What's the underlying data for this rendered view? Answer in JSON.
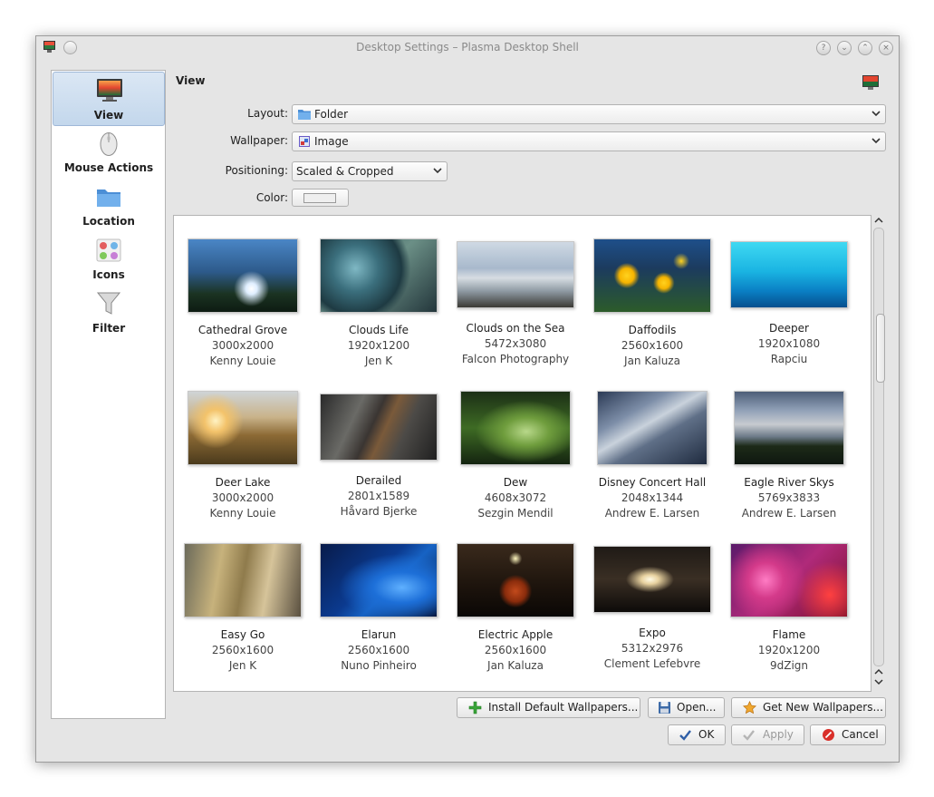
{
  "window": {
    "title": "Desktop Settings – Plasma Desktop Shell"
  },
  "sidebar": {
    "items": [
      {
        "label": "View",
        "icon": "monitor-icon",
        "active": true
      },
      {
        "label": "Mouse Actions",
        "icon": "mouse-icon",
        "active": false
      },
      {
        "label": "Location",
        "icon": "folder-icon",
        "active": false
      },
      {
        "label": "Icons",
        "icon": "icons-icon",
        "active": false
      },
      {
        "label": "Filter",
        "icon": "funnel-icon",
        "active": false
      }
    ]
  },
  "main": {
    "section_title": "View",
    "layout": {
      "label": "Layout:",
      "value": "Folder"
    },
    "wallpaper": {
      "label": "Wallpaper:",
      "value": "Image"
    },
    "positioning": {
      "label": "Positioning:",
      "value": "Scaled & Cropped"
    },
    "color": {
      "label": "Color:",
      "value": "#efefef"
    }
  },
  "wallpapers": [
    {
      "name": "Cathedral Grove",
      "size": "3000x2000",
      "author": "Kenny Louie"
    },
    {
      "name": "Clouds Life",
      "size": "1920x1200",
      "author": "Jen K"
    },
    {
      "name": "Clouds on the Sea",
      "size": "5472x3080",
      "author": "Falcon Photography"
    },
    {
      "name": "Daffodils",
      "size": "2560x1600",
      "author": "Jan Kaluza"
    },
    {
      "name": "Deeper",
      "size": "1920x1080",
      "author": "Rapciu"
    },
    {
      "name": "Deer Lake",
      "size": "3000x2000",
      "author": "Kenny Louie"
    },
    {
      "name": "Derailed",
      "size": "2801x1589",
      "author": "Håvard Bjerke"
    },
    {
      "name": "Dew",
      "size": "4608x3072",
      "author": "Sezgin Mendil"
    },
    {
      "name": "Disney Concert Hall",
      "size": "2048x1344",
      "author": "Andrew E. Larsen"
    },
    {
      "name": "Eagle River Skys",
      "size": "5769x3833",
      "author": "Andrew E. Larsen"
    },
    {
      "name": "Easy Go",
      "size": "2560x1600",
      "author": "Jen K"
    },
    {
      "name": "Elarun",
      "size": "2560x1600",
      "author": "Nuno Pinheiro"
    },
    {
      "name": "Electric Apple",
      "size": "2560x1600",
      "author": "Jan Kaluza"
    },
    {
      "name": "Expo",
      "size": "5312x2976",
      "author": "Clement Lefebvre"
    },
    {
      "name": "Flame",
      "size": "1920x1200",
      "author": "9dZign"
    }
  ],
  "buttons": {
    "install": "Install Default Wallpapers...",
    "open": "Open...",
    "get_new": "Get New Wallpapers...",
    "ok": "OK",
    "apply": "Apply",
    "cancel": "Cancel"
  },
  "colors": {
    "accent": "#c3d7ec",
    "window_bg": "#e5e5e5"
  }
}
